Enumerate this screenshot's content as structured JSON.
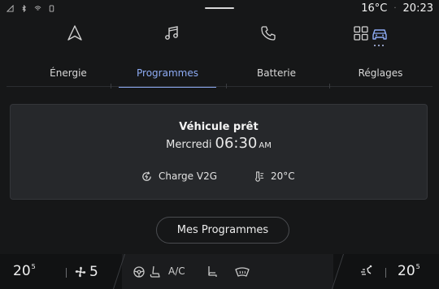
{
  "status_bar": {
    "system_icons": [
      "signal-icon",
      "bluetooth-icon",
      "wifi-icon",
      "phone-status-icon"
    ],
    "temperature": "16°C",
    "separator": "·",
    "time": "20:23"
  },
  "nav_icons": [
    {
      "name": "navigation-icon",
      "active": false
    },
    {
      "name": "music-icon",
      "active": false
    },
    {
      "name": "phone-icon",
      "active": false
    },
    {
      "name": "apps-grid-icon",
      "active": false
    },
    {
      "name": "car-icon",
      "active": true
    }
  ],
  "tabs": [
    {
      "label": "Énergie",
      "active": false
    },
    {
      "label": "Programmes",
      "active": true
    },
    {
      "label": "Batterie",
      "active": false
    },
    {
      "label": "Réglages",
      "active": false
    }
  ],
  "program_card": {
    "title": "Véhicule prêt",
    "day": "Mercredi",
    "time": "06:30",
    "ampm": "AM",
    "charge_label": "Charge V2G",
    "comfort_temp": "20°C"
  },
  "buttons": {
    "my_programs": "Mes Programmes"
  },
  "climate": {
    "left_temp": "20",
    "left_temp_decimal": "5",
    "fan_speed": "5",
    "ac_label": "A/C",
    "right_temp": "20",
    "right_temp_decimal": "5"
  },
  "colors": {
    "accent": "#8eacf5",
    "background": "#161718",
    "card": "#26282b"
  }
}
